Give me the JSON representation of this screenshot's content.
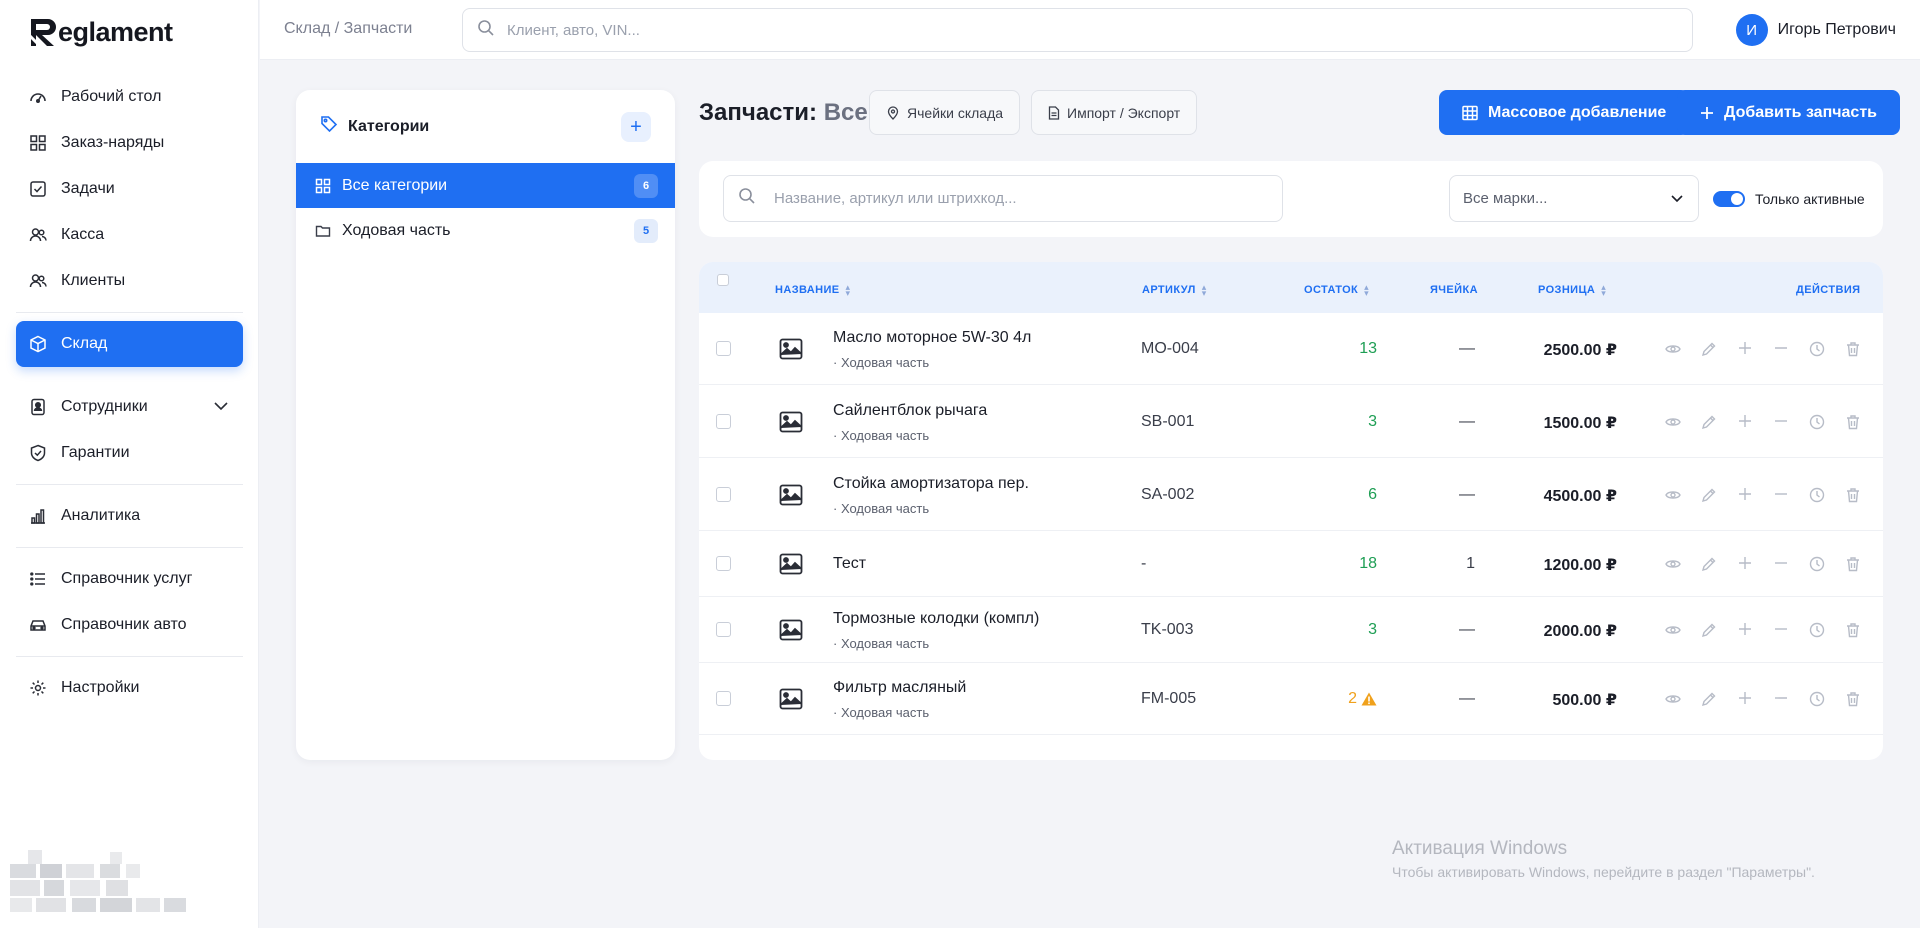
{
  "app": {
    "logo_text": "eglament",
    "logo_letter": "R"
  },
  "sidebar": {
    "items": [
      {
        "label": "Рабочий стол",
        "icon": "dashboard-icon"
      },
      {
        "label": "Заказ-наряды",
        "icon": "grid-icon"
      },
      {
        "label": "Задачи",
        "icon": "checkbox-icon"
      },
      {
        "label": "Касса",
        "icon": "users-icon"
      },
      {
        "label": "Клиенты",
        "icon": "users-icon"
      },
      {
        "label": "Склад",
        "icon": "box-icon",
        "active": true
      },
      {
        "label": "Сотрудники",
        "icon": "badge-icon"
      },
      {
        "label": "Гарантии",
        "icon": "shield-icon"
      },
      {
        "label": "Аналитика",
        "icon": "bar-chart-icon"
      },
      {
        "label": "Справочник услуг",
        "icon": "list-icon"
      },
      {
        "label": "Справочник авто",
        "icon": "car-icon"
      },
      {
        "label": "Настройки",
        "icon": "gear-icon"
      }
    ]
  },
  "header": {
    "breadcrumb": "Склад / Запчасти",
    "search_placeholder": "Клиент, авто, VIN...",
    "user_initial": "И",
    "user_name": "Игорь Петрович"
  },
  "categories": {
    "title": "Категории",
    "add_label": "+",
    "items": [
      {
        "label": "Все категории",
        "count": "6",
        "active": true
      },
      {
        "label": "Ходовая часть",
        "count": "5"
      }
    ]
  },
  "page": {
    "title_main": "Запчасти:",
    "title_sub": "Все",
    "btn_cells": "Ячейки склада",
    "btn_import": "Импорт / Экспорт",
    "btn_bulk": "Массовое добавление",
    "btn_add": "Добавить запчасть"
  },
  "filters": {
    "search_placeholder": "Название, артикул или штрихкод...",
    "brand_select": "Все марки...",
    "active_only": "Только активные",
    "active_only_on": true
  },
  "table": {
    "columns": {
      "name": "НАЗВАНИЕ",
      "sku": "АРТИКУЛ",
      "stock": "ОСТАТОК",
      "cell": "ЯЧЕЙКА",
      "price": "РОЗНИЦА",
      "actions": "ДЕЙСТВИЯ"
    },
    "rows": [
      {
        "name": "Масло моторное 5W-30 4л",
        "category": "· Ходовая часть",
        "sku": "MO-004",
        "stock": "13",
        "cell": "—",
        "price": "2500.00 ₽"
      },
      {
        "name": "Сайлентблок рычага",
        "category": "· Ходовая часть",
        "sku": "SB-001",
        "stock": "3",
        "cell": "—",
        "price": "1500.00 ₽"
      },
      {
        "name": "Стойка амортизатора пер.",
        "category": "· Ходовая часть",
        "sku": "SA-002",
        "stock": "6",
        "cell": "—",
        "price": "4500.00 ₽"
      },
      {
        "name": "Тест",
        "category": "",
        "sku": "-",
        "stock": "18",
        "cell": "1",
        "price": "1200.00 ₽"
      },
      {
        "name": "Тормозные колодки (компл)",
        "category": "· Ходовая часть",
        "sku": "TK-003",
        "stock": "3",
        "cell": "—",
        "price": "2000.00 ₽"
      },
      {
        "name": "Фильтр масляный",
        "category": "· Ходовая часть",
        "sku": "FM-005",
        "stock": "2",
        "stock_warning": true,
        "cell": "—",
        "price": "500.00 ₽"
      }
    ]
  },
  "watermark": {
    "title": "Активация Windows",
    "text": "Чтобы активировать Windows, перейдите в раздел \"Параметры\"."
  },
  "colors": {
    "accent": "#1f6ff2",
    "stock_ok": "#1e9e54",
    "stock_warn": "#f0a11c"
  }
}
